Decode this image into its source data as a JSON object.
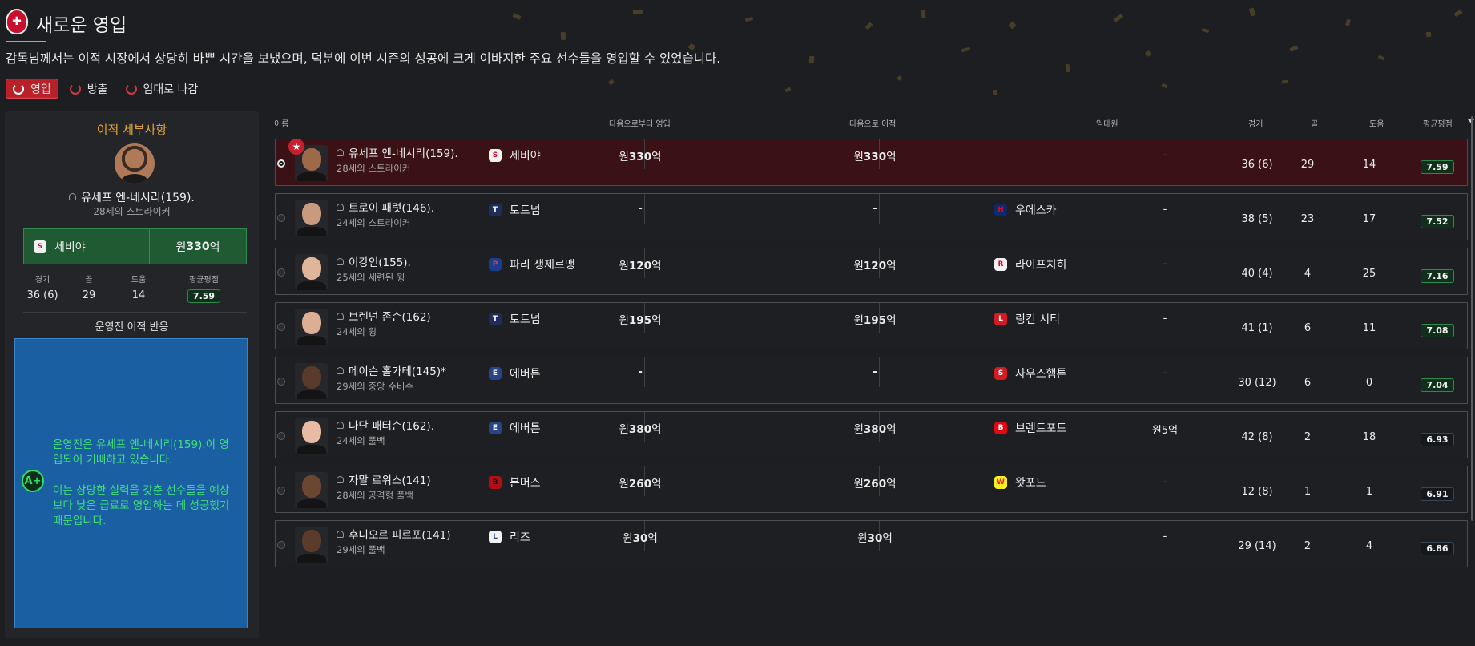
{
  "header": {
    "title": "새로운 영입",
    "subtitle": "감독님께서는 이적 시장에서 상당히 바쁜 시간을 보냈으며, 덕분에 이번 시즌의 성공에 크게 이바지한 주요 선수들을 영입할 수 있었습니다."
  },
  "tabs": [
    {
      "label": "영입",
      "active": true
    },
    {
      "label": "방출",
      "active": false
    },
    {
      "label": "임대로 나감",
      "active": false
    }
  ],
  "detail": {
    "heading": "이적 세부사항",
    "player_name": "유세프 엔-네시리(159).",
    "player_desc": "28세의 스트라이커",
    "from_club": "세비야",
    "fee_prefix": "원",
    "fee_value": "330",
    "fee_suffix": "억",
    "stats_labels": {
      "apps": "경기",
      "goals": "골",
      "assists": "도움",
      "rating": "평균평점"
    },
    "stats": {
      "apps": "36 (6)",
      "goals": "29",
      "assists": "14",
      "rating": "7.59"
    },
    "reaction_title": "운영진 이적 반응",
    "grade": "A+",
    "reaction_p1": "운영진은 유세프 엔-네시리(159).이 영입되어 기뻐하고 있습니다.",
    "reaction_p2": "이는 상당한 실력을 갖춘 선수들을 예상보다 낮은 급료로 영입하는 데 성공했기 때문입니다."
  },
  "columns": {
    "name": "이름",
    "from": "다음으로부터 영입",
    "to": "다음으로 이적",
    "wage": "임대원",
    "apps": "경기",
    "goals": "골",
    "assists": "도움",
    "rating": "평균평점"
  },
  "rows": [
    {
      "name": "유세프 엔-네시리(159).",
      "desc": "28세의 스트라이커",
      "from": "세비야",
      "fee_in_pre": "원",
      "fee_in": "330",
      "fee_in_suf": "억",
      "fee_out_pre": "원",
      "fee_out": "330",
      "fee_out_suf": "억",
      "to": "",
      "wage": "-",
      "apps": "36 (6)",
      "goals": "29",
      "assists": "14",
      "rating": "7.59"
    },
    {
      "name": "트로이 패럿(146).",
      "desc": "24세의 스트라이커",
      "from": "토트넘",
      "fee_in_pre": "",
      "fee_in": "-",
      "fee_in_suf": "",
      "fee_out_pre": "",
      "fee_out": "-",
      "fee_out_suf": "",
      "to": "우에스카",
      "wage": "-",
      "apps": "38 (5)",
      "goals": "23",
      "assists": "17",
      "rating": "7.52"
    },
    {
      "name": "이강인(155).",
      "desc": "25세의 세련된 윙",
      "from": "파리 생제르맹",
      "fee_in_pre": "원",
      "fee_in": "120",
      "fee_in_suf": "억",
      "fee_out_pre": "원",
      "fee_out": "120",
      "fee_out_suf": "억",
      "to": "라이프치히",
      "wage": "-",
      "apps": "40 (4)",
      "goals": "4",
      "assists": "25",
      "rating": "7.16"
    },
    {
      "name": "브렌넌 존슨(162)",
      "desc": "24세의 윙",
      "from": "토트넘",
      "fee_in_pre": "원",
      "fee_in": "195",
      "fee_in_suf": "억",
      "fee_out_pre": "원",
      "fee_out": "195",
      "fee_out_suf": "억",
      "to": "링컨 시티",
      "wage": "-",
      "apps": "41 (1)",
      "goals": "6",
      "assists": "11",
      "rating": "7.08"
    },
    {
      "name": "메이슨 홀가테(145)*",
      "desc": "29세의 중앙 수비수",
      "from": "에버튼",
      "fee_in_pre": "",
      "fee_in": "-",
      "fee_in_suf": "",
      "fee_out_pre": "",
      "fee_out": "-",
      "fee_out_suf": "",
      "to": "사우스햄튼",
      "wage": "-",
      "apps": "30 (12)",
      "goals": "6",
      "assists": "0",
      "rating": "7.04"
    },
    {
      "name": "나단 패터슨(162).",
      "desc": "24세의 풀백",
      "from": "에버튼",
      "fee_in_pre": "원",
      "fee_in": "380",
      "fee_in_suf": "억",
      "fee_out_pre": "원",
      "fee_out": "380",
      "fee_out_suf": "억",
      "to": "브렌트포드",
      "wage": "원5억",
      "apps": "42 (8)",
      "goals": "2",
      "assists": "18",
      "rating": "6.93"
    },
    {
      "name": "자말 르위스(141)",
      "desc": "28세의 공격형 풀백",
      "from": "본머스",
      "fee_in_pre": "원",
      "fee_in": "260",
      "fee_in_suf": "억",
      "fee_out_pre": "원",
      "fee_out": "260",
      "fee_out_suf": "억",
      "to": "왓포드",
      "wage": "-",
      "apps": "12 (8)",
      "goals": "1",
      "assists": "1",
      "rating": "6.91"
    },
    {
      "name": "후니오르 피르포(141)",
      "desc": "29세의 풀백",
      "from": "리즈",
      "fee_in_pre": "원",
      "fee_in": "30",
      "fee_in_suf": "억",
      "fee_out_pre": "원",
      "fee_out": "30",
      "fee_out_suf": "억",
      "to": "",
      "wage": "-",
      "apps": "29 (14)",
      "goals": "2",
      "assists": "4",
      "rating": "6.86"
    }
  ],
  "colors": {
    "accent_red": "#b8202a",
    "panel_green": "#1f5a33",
    "reaction_blue": "#1a5fa1",
    "reaction_text": "#43e07a",
    "heading_gold": "#e2a43a"
  }
}
